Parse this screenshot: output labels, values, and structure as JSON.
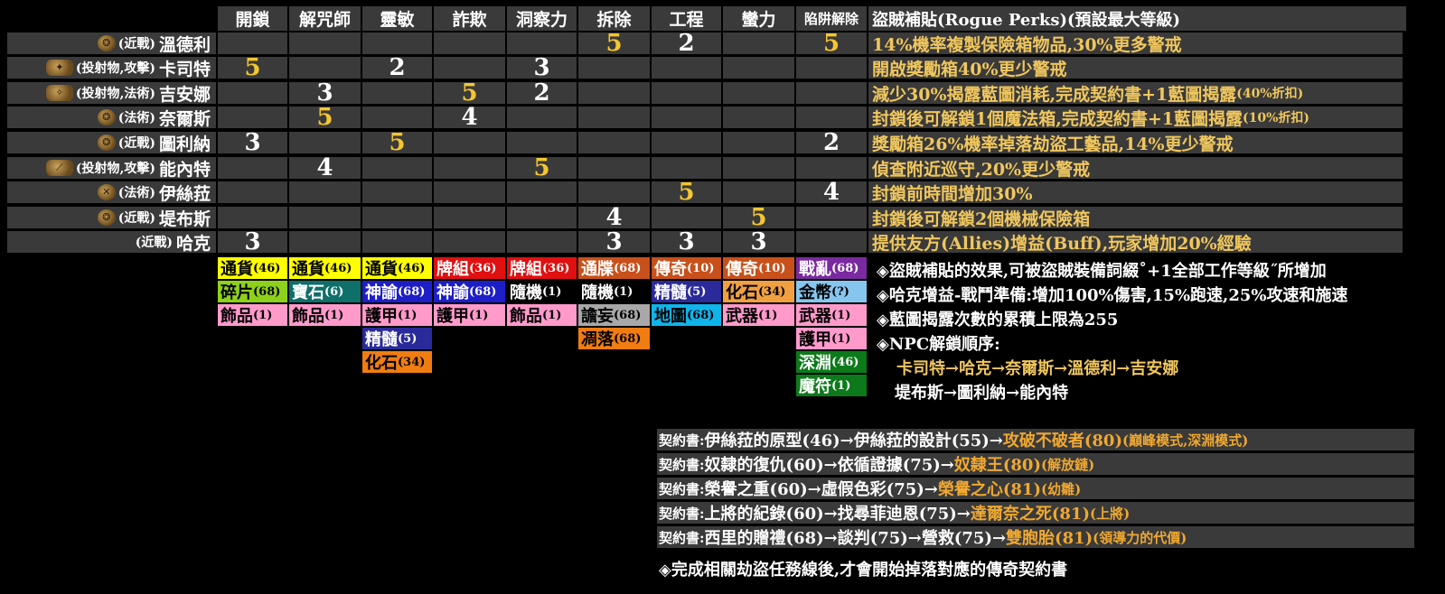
{
  "headers": [
    "開鎖",
    "解咒師",
    "靈敏",
    "詐欺",
    "洞察力",
    "拆除",
    "工程",
    "蠻力",
    "陷阱解除",
    "盜賊補貼(Rogue Perks)(預設最大等級)"
  ],
  "npcs": [
    {
      "tag": "(近戰)",
      "name": "溫德利",
      "icon": "❂",
      "values": [
        "",
        "",
        "",
        "",
        "",
        "5",
        "2",
        "",
        "5"
      ],
      "perk_main": "14%機率複製保險箱物品,30%更多警戒",
      "perk_small": ""
    },
    {
      "tag": "(投射物,攻擊)",
      "name": "卡司特",
      "icon": "✦",
      "values": [
        "5",
        "",
        "2",
        "",
        "3",
        "",
        "",
        "",
        ""
      ],
      "perk_main": "開啟獎勵箱40%更少警戒",
      "perk_small": ""
    },
    {
      "tag": "(投射物,法術)",
      "name": "吉安娜",
      "icon": "✧",
      "values": [
        "",
        "3",
        "",
        "5",
        "2",
        "",
        "",
        "",
        ""
      ],
      "perk_main": "減少30%揭露藍圖消耗,完成契約書+1藍圖揭露",
      "perk_small": "(40%折扣)"
    },
    {
      "tag": "(法術)",
      "name": "奈爾斯",
      "icon": "❂",
      "values": [
        "",
        "5",
        "",
        "4",
        "",
        "",
        "",
        "",
        ""
      ],
      "perk_main": "封鎖後可解鎖1個魔法箱,完成契約書+1藍圖揭露",
      "perk_small": "(10%折扣)"
    },
    {
      "tag": "(近戰)",
      "name": "圖利納",
      "icon": "❂",
      "values": [
        "3",
        "",
        "5",
        "",
        "",
        "",
        "",
        "",
        "2"
      ],
      "perk_main": "獎勵箱26%機率掉落劫盜工藝品,14%更少警戒",
      "perk_small": ""
    },
    {
      "tag": "(投射物,攻擊)",
      "name": "能內特",
      "icon": "⟋",
      "values": [
        "",
        "4",
        "",
        "",
        "5",
        "",
        "",
        "",
        ""
      ],
      "perk_main": "偵查附近巡守,20%更少警戒",
      "perk_small": ""
    },
    {
      "tag": "(法術)",
      "name": "伊絲菈",
      "icon": "✕",
      "values": [
        "",
        "",
        "",
        "",
        "",
        "",
        "5",
        "",
        "4"
      ],
      "perk_main": "封鎖前時間增加30%",
      "perk_small": ""
    },
    {
      "tag": "(近戰)",
      "name": "堤布斯",
      "icon": "❂",
      "values": [
        "",
        "",
        "",
        "",
        "",
        "4",
        "",
        "5",
        ""
      ],
      "perk_main": "封鎖後可解鎖2個機械保險箱",
      "perk_small": ""
    },
    {
      "tag": "(近戰)",
      "name": "哈克",
      "icon": "",
      "values": [
        "3",
        "",
        "",
        "",
        "",
        "3",
        "3",
        "3",
        ""
      ],
      "perk_main": "提供友方(Allies)增益(Buff),玩家增加20%經驗",
      "perk_small": ""
    }
  ],
  "rewards": [
    [
      {
        "t": "通貨",
        "n": "(46)",
        "c": "yellow"
      },
      {
        "t": "碎片",
        "n": "(68)",
        "c": "lime"
      },
      {
        "t": "飾品",
        "n": "(1)",
        "c": "pink"
      }
    ],
    [
      {
        "t": "通貨",
        "n": "(46)",
        "c": "yellow"
      },
      {
        "t": "寶石",
        "n": "(6)",
        "c": "teal"
      },
      {
        "t": "飾品",
        "n": "(1)",
        "c": "pink"
      }
    ],
    [
      {
        "t": "通貨",
        "n": "(46)",
        "c": "yellow"
      },
      {
        "t": "神諭",
        "n": "(68)",
        "c": "blue"
      },
      {
        "t": "護甲",
        "n": "(1)",
        "c": "pink"
      },
      {
        "t": "精髓",
        "n": "(5)",
        "c": "navy"
      },
      {
        "t": "化石",
        "n": "(34)",
        "c": "orange"
      }
    ],
    [
      {
        "t": "牌組",
        "n": "(36)",
        "c": "red"
      },
      {
        "t": "神諭",
        "n": "(68)",
        "c": "blue"
      },
      {
        "t": "護甲",
        "n": "(1)",
        "c": "pink"
      }
    ],
    [
      {
        "t": "牌組",
        "n": "(36)",
        "c": "red"
      },
      {
        "t": "隨機",
        "n": "(1)",
        "c": "black"
      },
      {
        "t": "飾品",
        "n": "(1)",
        "c": "pink"
      }
    ],
    [
      {
        "t": "通牒",
        "n": "(68)",
        "c": "darkred"
      },
      {
        "t": "隨機",
        "n": "(1)",
        "c": "black"
      },
      {
        "t": "譫妄",
        "n": "(68)",
        "c": "gray"
      },
      {
        "t": "凋落",
        "n": "(68)",
        "c": "orange"
      }
    ],
    [
      {
        "t": "傳奇",
        "n": "(10)",
        "c": "darkred"
      },
      {
        "t": "精髓",
        "n": "(5)",
        "c": "navy"
      },
      {
        "t": "地圖",
        "n": "(68)",
        "c": "sky"
      }
    ],
    [
      {
        "t": "傳奇",
        "n": "(10)",
        "c": "darkred"
      },
      {
        "t": "化石",
        "n": "(34)",
        "c": "peach"
      },
      {
        "t": "武器",
        "n": "(1)",
        "c": "pink"
      }
    ],
    [
      {
        "t": "戰亂",
        "n": "(68)",
        "c": "purple"
      },
      {
        "t": "金幣",
        "n": "(?)",
        "c": "lightblue"
      },
      {
        "t": "武器",
        "n": "(1)",
        "c": "pink"
      },
      {
        "t": "護甲",
        "n": "(1)",
        "c": "pink"
      },
      {
        "t": "深淵",
        "n": "(46)",
        "c": "green"
      },
      {
        "t": "魔符",
        "n": "(1)",
        "c": "green"
      }
    ]
  ],
  "notes": {
    "n1": "◈盜賊補貼的效果,可被盜賊裝備詞綴˚+1全部工作等級˝所增加",
    "n2": "◈哈克增益-戰鬥準備:增加100%傷害,15%跑速,25%攻速和施速",
    "n3": "◈藍圖揭露次數的累積上限為255",
    "n4": "◈NPC解鎖順序:",
    "n5": "卡司特→哈克→奈爾斯→溫德利→吉安娜",
    "n6": "堤布斯→圖利納→能內特"
  },
  "contracts": [
    {
      "label": "契約書:",
      "path": "伊絲菈的原型(46)→伊絲菈的設計(55)→",
      "reward": "攻破不破者(80)",
      "extra": "(巔峰模式,深淵模式)"
    },
    {
      "label": "契約書:",
      "path": "奴隸的復仇(60)→依循證據(75)→",
      "reward": "奴隸王(80)",
      "extra": "(解放鏈)"
    },
    {
      "label": "契約書:",
      "path": "榮譽之重(60)→虛假色彩(75)→",
      "reward": "榮譽之心(81)",
      "extra": "(幼雛)"
    },
    {
      "label": "契約書:",
      "path": "上將的紀錄(60)→找尋菲迪恩(75)→",
      "reward": "達爾奈之死(81)",
      "extra": "(上將)"
    },
    {
      "label": "契約書:",
      "path": "西里的贈禮(68)→談判(75)→營救(75)→",
      "reward": "雙胞胎(81)",
      "extra": "(領導力的代價)"
    }
  ],
  "footer": "◈完成相關劫盜任務線後,才會開始掉落對應的傳奇契約書",
  "colors": {
    "gold": "#f4c630",
    "cell_bg": "#3a3a3a",
    "perk_text": "#f0c75e"
  }
}
